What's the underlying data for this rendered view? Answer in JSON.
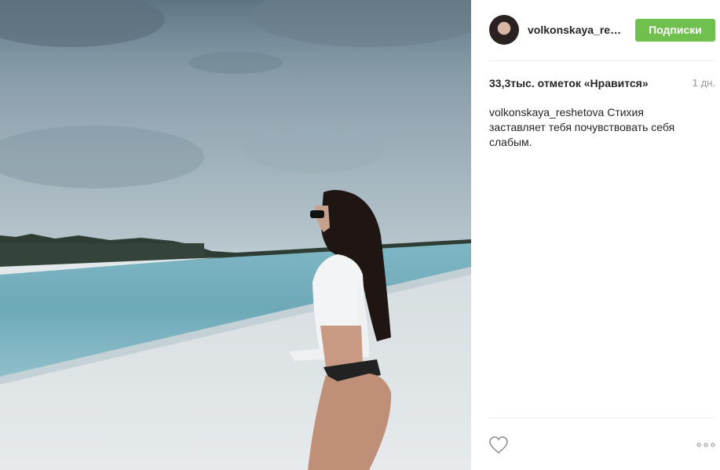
{
  "post": {
    "author": {
      "username_display": "volkonskaya_re…",
      "follow_button_label": "Подписки"
    },
    "likes_text": "33,3тыс. отметок «Нравится»",
    "time_ago": "1 дн.",
    "caption": {
      "username": "volkonskaya_reshetova",
      "text": " Стихия заставляет тебя почувствовать себя слабым."
    },
    "actions": {
      "like_icon": "heart-icon",
      "more_icon": "more-options-icon"
    }
  },
  "colors": {
    "follow_button": "#70c050",
    "text_primary": "#262626",
    "text_muted": "#999999"
  }
}
